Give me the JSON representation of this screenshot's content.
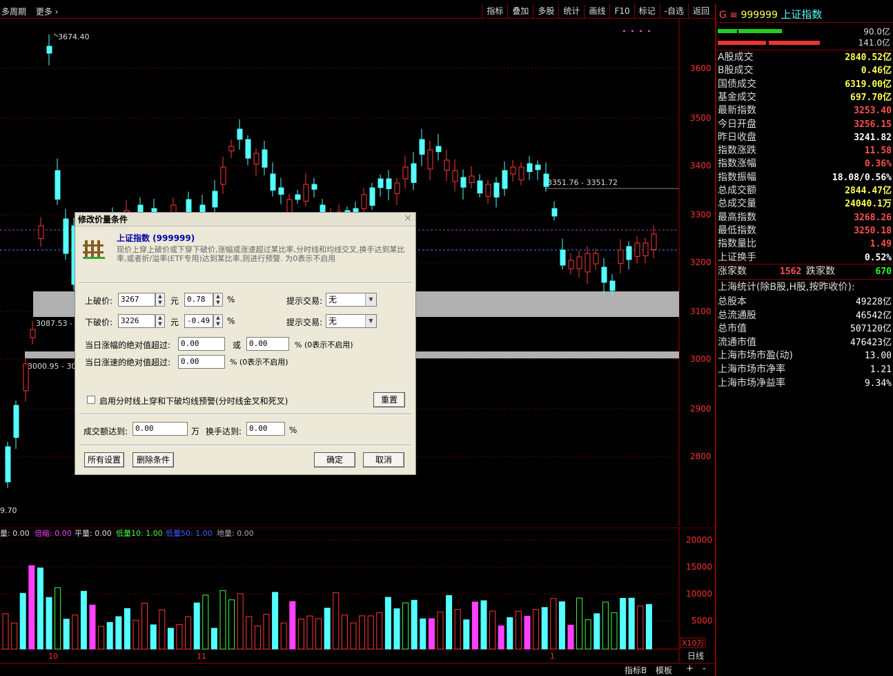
{
  "topbar": {
    "left": [
      "多周期",
      "更多 ›"
    ],
    "menu": [
      "指标",
      "叠加",
      "多股",
      "统计",
      "画线",
      "F10",
      "标记",
      "-自选",
      "返回"
    ]
  },
  "chart": {
    "price_labels": [
      "3600",
      "3500",
      "3400",
      "3300",
      "3200",
      "3100",
      "3000",
      "2900",
      "2800"
    ],
    "annot_high": "3674.40",
    "annot_low": "9.70",
    "annot_range": "3351.76 - 3351.72",
    "annot_3087": "3087.53 - 3",
    "annot_3000": "3000.95 - 30",
    "vol_legend": {
      "a": "量: 0.00",
      "b": "倍缩: 0.00",
      "c": "平量: 0.00",
      "d": "低量10: 1.00",
      "e": "低量50: 1.00",
      "f": "地量: 0.00"
    },
    "vol_labels": [
      "20000",
      "15000",
      "10000",
      "5000"
    ],
    "vol_unit": "X10万",
    "date_labels": [
      "10",
      "11",
      "1"
    ],
    "bottom": [
      "指标B",
      "模板",
      "+",
      "-"
    ],
    "period": "日线"
  },
  "side": {
    "code_prefix": "G ≡",
    "code": "999999",
    "name": "上证指数",
    "bar1": "90.0亿",
    "bar2": "141.0亿",
    "rows": [
      {
        "k": "A股成交",
        "v": "2840.52亿",
        "c": "yel"
      },
      {
        "k": "B股成交",
        "v": "0.46亿",
        "c": "yel"
      },
      {
        "k": "国债成交",
        "v": "6319.00亿",
        "c": "yel"
      },
      {
        "k": "基金成交",
        "v": "697.70亿",
        "c": "yel"
      },
      {
        "k": "最新指数",
        "v": "3253.40",
        "c": "red"
      },
      {
        "k": "今日开盘",
        "v": "3256.15",
        "c": "red"
      },
      {
        "k": "昨日收盘",
        "v": "3241.82",
        "c": "wht"
      },
      {
        "k": "指数涨跌",
        "v": "11.58",
        "c": "red"
      },
      {
        "k": "指数涨幅",
        "v": "0.36%",
        "c": "red"
      },
      {
        "k": "指数振幅",
        "v": "18.08/0.56%",
        "c": "wht"
      },
      {
        "k": "总成交额",
        "v": "2844.47亿",
        "c": "yel"
      },
      {
        "k": "总成交量",
        "v": "24040.1万",
        "c": "yel"
      },
      {
        "k": "最高指数",
        "v": "3268.26",
        "c": "red"
      },
      {
        "k": "最低指数",
        "v": "3250.18",
        "c": "red"
      },
      {
        "k": "指数量比",
        "v": "1.49",
        "c": "red"
      },
      {
        "k": "上证换手",
        "v": "0.52%",
        "c": "wht"
      }
    ],
    "rise_label": "涨家数",
    "rise": "1562",
    "fall_label": "跌家数",
    "fall": "670",
    "stat_title": "上海统计(除B股,H股,按昨收价):",
    "rows2": [
      {
        "k": "总股本",
        "v": "49228亿"
      },
      {
        "k": "总流通股",
        "v": "46542亿"
      },
      {
        "k": "总市值",
        "v": "507120亿"
      },
      {
        "k": "流通市值",
        "v": "476423亿"
      },
      {
        "k": "上海市场市盈(动)",
        "v": "13.00"
      },
      {
        "k": "上海市场市净率",
        "v": "1.21"
      },
      {
        "k": "上海市场净益率",
        "v": "9.34%"
      }
    ]
  },
  "dialog": {
    "title": "修改价量条件",
    "close": "×",
    "stock_name": "上证指数 (999999)",
    "desc": "现价上穿上破价或下穿下破价,涨幅或涨速超过某比率,分时线和均线交叉,换手达到某比率,或者折/溢率(ETF专用)达到某比率,则进行预警. 为0表示不启用",
    "up_label": "上破价:",
    "up_val": "3267",
    "up_unit": "元",
    "up_pct": "0.78",
    "pct": "%",
    "down_label": "下破价:",
    "down_val": "3226",
    "down_unit": "元",
    "down_pct": "-0.49",
    "tip_label": "提示交易:",
    "tip_val": "无",
    "rise_label": "当日涨幅的绝对值超过:",
    "rise_val": "0.00",
    "or": "或",
    "rise_val2": "0.00",
    "rise_note": "% (0表示不启用)",
    "speed_label": "当日涨速的绝对值超过:",
    "speed_val": "0.00",
    "speed_note": "% (0表示不启用)",
    "cross_label": "启用分时线上穿和下破均线预警(分时线金叉和死叉)",
    "reset": "重置",
    "amt_label": "成交额达到:",
    "amt_val": "0.00",
    "amt_unit": "万",
    "turn_label": "换手达到:",
    "turn_val": "0.00",
    "btn_all": "所有设置",
    "btn_del": "删除条件",
    "btn_ok": "确定",
    "btn_cancel": "取消"
  }
}
